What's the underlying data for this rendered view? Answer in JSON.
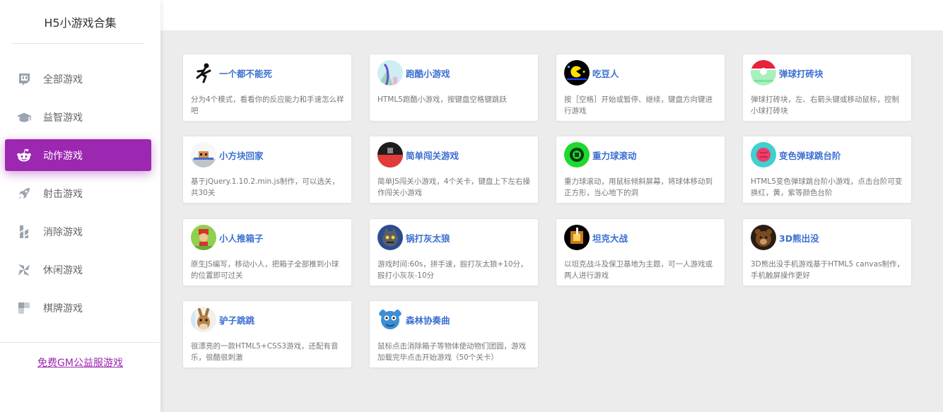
{
  "app": {
    "title": "H5小游戏合集"
  },
  "sidebar": {
    "items": [
      {
        "label": "全部游戏",
        "icon": "twitch-icon"
      },
      {
        "label": "益智游戏",
        "icon": "graduation-cap-icon"
      },
      {
        "label": "动作游戏",
        "icon": "reddit-alien-icon",
        "active": true
      },
      {
        "label": "射击游戏",
        "icon": "rocket-icon"
      },
      {
        "label": "消除游戏",
        "icon": "hubspot-like-icon"
      },
      {
        "label": "休闲游戏",
        "icon": "pinwheel-icon"
      },
      {
        "label": "棋牌游戏",
        "icon": "checker-icon"
      }
    ],
    "footer_link": "免费GM公益服游戏"
  },
  "theme": {
    "accent": "#9c27b0",
    "title_color": "#3a6fd2"
  },
  "games": [
    {
      "title": "一个都不能死",
      "desc": "分为4个模式，看看你的反应能力和手速怎么样吧",
      "icon": "running-man-icon"
    },
    {
      "title": "跑酷小游戏",
      "desc": "HTML5跑酷小游戏，按键盘空格键跳跃",
      "icon": "parkour-icon"
    },
    {
      "title": "吃豆人",
      "desc": "按［空格］开始或暂停、继续，键盘方向键进行游戏",
      "icon": "pacman-icon"
    },
    {
      "title": "弹球打砖块",
      "desc": "弹球打砖块，左、右箭头键或移动鼠标，控制小球打砖块",
      "icon": "breakout-icon"
    },
    {
      "title": "小方块回家",
      "desc": "基于jQuery.1.10.2.min.js制作，可以选关，共30关",
      "icon": "block-home-icon"
    },
    {
      "title": "简单闯关游戏",
      "desc": "简单JS闯关小游戏，4个关卡，键盘上下左右操作闯关小游戏",
      "icon": "level-game-icon"
    },
    {
      "title": "重力球滚动",
      "desc": "重力球滚动，用鼠标倾斜屏幕，将球体移动到正方形，当心地下的洞",
      "icon": "gravity-ball-icon"
    },
    {
      "title": "变色弹球跳台阶",
      "desc": "HTML5变色弹球跳台阶小游戏，点击台阶可变换红，黄，紫等颜色台阶",
      "icon": "color-ball-icon"
    },
    {
      "title": "小人推箱子",
      "desc": "原生JS编写，移动小人，把箱子全部推到小球的位置即可过关",
      "icon": "sokoban-icon"
    },
    {
      "title": "锅打灰太狼",
      "desc": "游戏时间:60s，拼手速，殴打灰太狼+10分，殴打小灰灰-10分",
      "icon": "wolf-icon"
    },
    {
      "title": "坦克大战",
      "desc": "以坦克战斗及保卫基地为主题，可一人游戏或两人进行游戏",
      "icon": "tank-icon"
    },
    {
      "title": "3D熊出没",
      "desc": "3D熊出没手机游戏基于HTML5 canvas制作，手机触屏操作更好",
      "icon": "bear-icon"
    },
    {
      "title": "驴子跳跳",
      "desc": "很漂亮的一款HTML5+CSS3游戏，还配有音乐，很酷很刺激",
      "icon": "donkey-icon"
    },
    {
      "title": "森林协奏曲",
      "desc": "鼠标点击消除箱子等物体使动物们团圆，游戏加载完毕点击开始游戏（50个关卡）",
      "icon": "forest-animal-icon"
    }
  ]
}
